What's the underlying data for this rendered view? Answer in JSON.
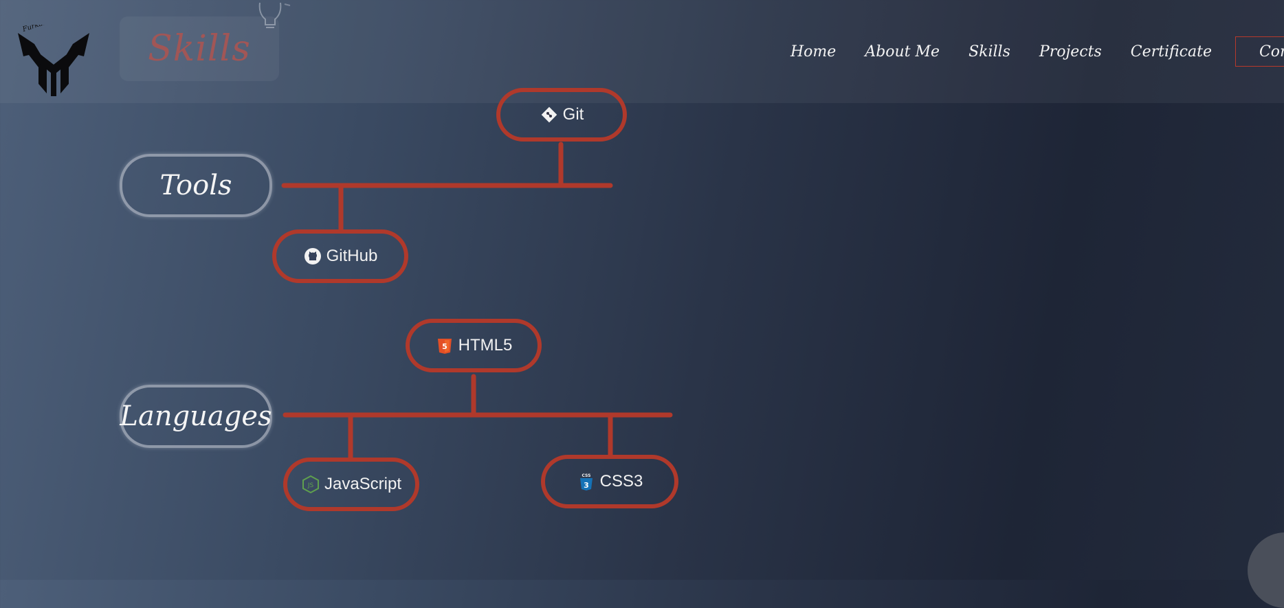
{
  "header": {
    "logo_text": "Furkan Fuqiri",
    "section_title": "Skills"
  },
  "nav": {
    "items": [
      "Home",
      "About Me",
      "Skills",
      "Projects",
      "Certificate"
    ],
    "contact": "Contact"
  },
  "tree": {
    "tools": {
      "label": "Tools",
      "items": [
        {
          "label": "Git",
          "icon": "git-icon"
        },
        {
          "label": "GitHub",
          "icon": "github-icon"
        }
      ]
    },
    "languages": {
      "label": "Languages",
      "items": [
        {
          "label": "HTML5",
          "icon": "html5-icon"
        },
        {
          "label": "JavaScript",
          "icon": "javascript-icon"
        },
        {
          "label": "CSS3",
          "icon": "css3-icon"
        }
      ]
    }
  },
  "colors": {
    "accent": "#b0392b",
    "title": "#a15656"
  }
}
